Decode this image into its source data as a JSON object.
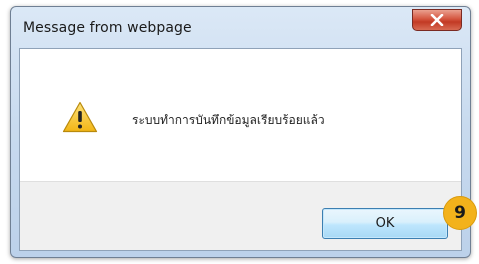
{
  "dialog": {
    "title": "Message from webpage",
    "message": "ระบบทำการบันทึกข้อมูลเรียบร้อยแล้ว",
    "ok_label": "OK",
    "icon": "warning-icon",
    "close_icon": "close-icon"
  },
  "annotation": {
    "step_number": "9",
    "color": "#f3b21b"
  }
}
